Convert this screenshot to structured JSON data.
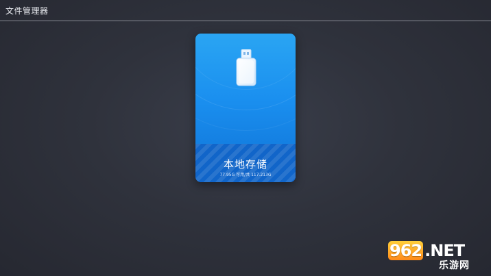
{
  "app": {
    "title": "文件管理器"
  },
  "storage": {
    "title": "本地存储",
    "capacity": "77.95G 可用/共 117.213G",
    "icon": "usb-drive-icon",
    "colors": {
      "card_top": "#2aa5f3",
      "card_bottom": "#0f72d6",
      "footer": "#1165c9"
    }
  },
  "watermark": {
    "logo_number": "962",
    "logo_suffix": ".NET",
    "subtitle": "乐游网"
  }
}
